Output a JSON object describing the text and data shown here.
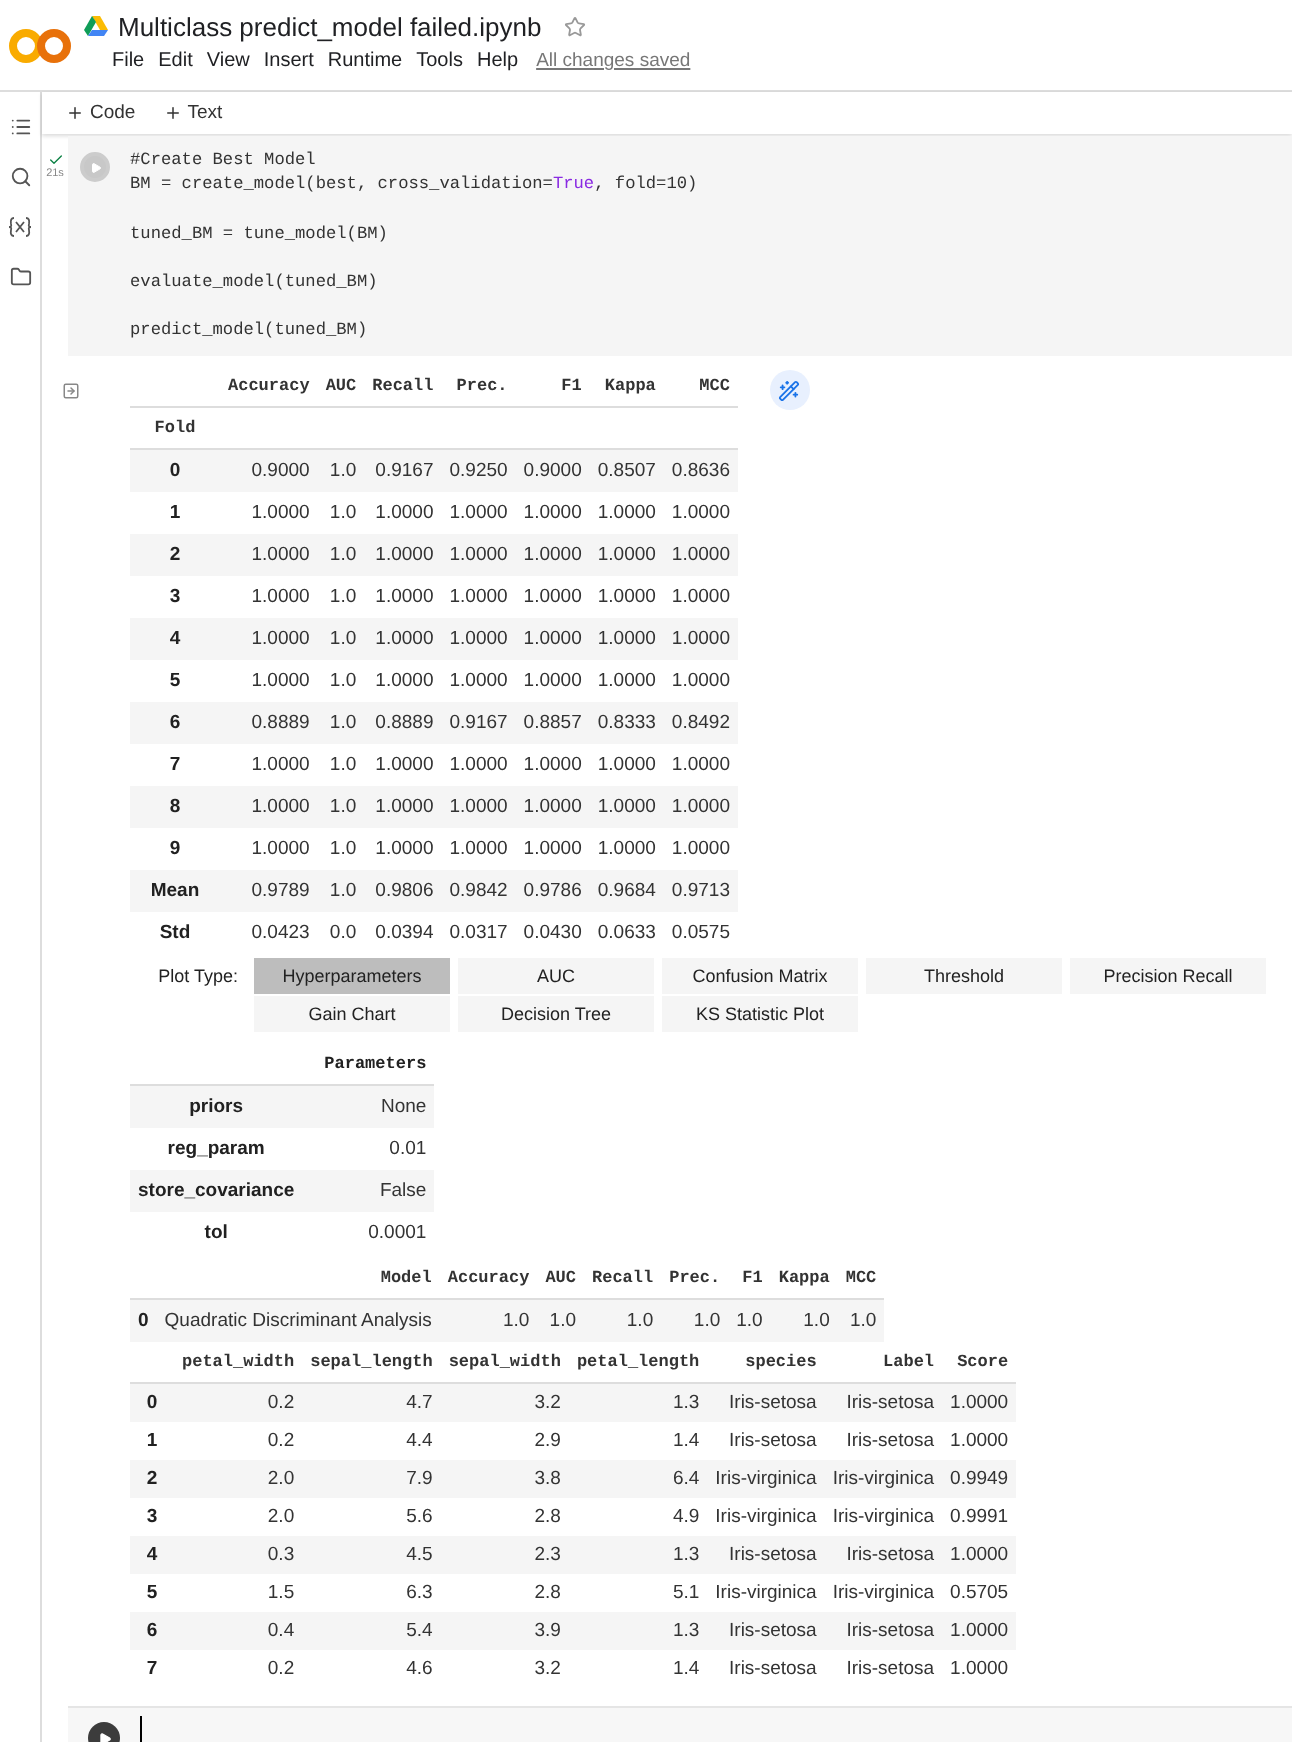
{
  "header": {
    "title": "Multiclass predict_model failed.ipynb",
    "menu": [
      "File",
      "Edit",
      "View",
      "Insert",
      "Runtime",
      "Tools",
      "Help"
    ],
    "save_status": "All changes saved"
  },
  "toolbar": [
    "Code",
    "Text"
  ],
  "code_cell": {
    "exec_time": "21s",
    "done": true,
    "blocks": [
      [
        [
          {
            "text": "#Create Best Model",
            "kind": "comment"
          }
        ],
        [
          {
            "text": "BM = create_model(best, cross_validation=",
            "kind": "plain"
          },
          {
            "text": "True",
            "kind": "keyword"
          },
          {
            "text": ", fold=10)",
            "kind": "plain"
          }
        ]
      ],
      [
        [
          {
            "text": "tuned_BM = tune_model(BM)",
            "kind": "plain"
          }
        ]
      ],
      [
        [
          {
            "text": "evaluate_model(tuned_BM)",
            "kind": "plain"
          }
        ]
      ],
      [
        [
          {
            "text": "predict_model(tuned_BM)",
            "kind": "plain"
          }
        ]
      ]
    ]
  },
  "scores": {
    "columns": [
      "Accuracy",
      "AUC",
      "Recall",
      "Prec.",
      "F1",
      "Kappa",
      "MCC"
    ],
    "index_name": "Fold",
    "rows": [
      {
        "index": "0",
        "values": [
          "0.9000",
          "1.0",
          "0.9167",
          "0.9250",
          "0.9000",
          "0.8507",
          "0.8636"
        ]
      },
      {
        "index": "1",
        "values": [
          "1.0000",
          "1.0",
          "1.0000",
          "1.0000",
          "1.0000",
          "1.0000",
          "1.0000"
        ]
      },
      {
        "index": "2",
        "values": [
          "1.0000",
          "1.0",
          "1.0000",
          "1.0000",
          "1.0000",
          "1.0000",
          "1.0000"
        ]
      },
      {
        "index": "3",
        "values": [
          "1.0000",
          "1.0",
          "1.0000",
          "1.0000",
          "1.0000",
          "1.0000",
          "1.0000"
        ]
      },
      {
        "index": "4",
        "values": [
          "1.0000",
          "1.0",
          "1.0000",
          "1.0000",
          "1.0000",
          "1.0000",
          "1.0000"
        ]
      },
      {
        "index": "5",
        "values": [
          "1.0000",
          "1.0",
          "1.0000",
          "1.0000",
          "1.0000",
          "1.0000",
          "1.0000"
        ]
      },
      {
        "index": "6",
        "values": [
          "0.8889",
          "1.0",
          "0.8889",
          "0.9167",
          "0.8857",
          "0.8333",
          "0.8492"
        ]
      },
      {
        "index": "7",
        "values": [
          "1.0000",
          "1.0",
          "1.0000",
          "1.0000",
          "1.0000",
          "1.0000",
          "1.0000"
        ]
      },
      {
        "index": "8",
        "values": [
          "1.0000",
          "1.0",
          "1.0000",
          "1.0000",
          "1.0000",
          "1.0000",
          "1.0000"
        ]
      },
      {
        "index": "9",
        "values": [
          "1.0000",
          "1.0",
          "1.0000",
          "1.0000",
          "1.0000",
          "1.0000",
          "1.0000"
        ]
      },
      {
        "index": "Mean",
        "values": [
          "0.9789",
          "1.0",
          "0.9806",
          "0.9842",
          "0.9786",
          "0.9684",
          "0.9713"
        ]
      },
      {
        "index": "Std",
        "values": [
          "0.0423",
          "0.0",
          "0.0394",
          "0.0317",
          "0.0430",
          "0.0633",
          "0.0575"
        ]
      }
    ]
  },
  "plot_type": {
    "label": "Plot Type:",
    "options": [
      {
        "label": "Hyperparameters",
        "selected": true
      },
      {
        "label": "AUC",
        "selected": false
      },
      {
        "label": "Confusion Matrix",
        "selected": false
      },
      {
        "label": "Threshold",
        "selected": false
      },
      {
        "label": "Precision Recall",
        "selected": false
      },
      {
        "label": "Gain Chart",
        "selected": false
      },
      {
        "label": "Decision Tree",
        "selected": false
      },
      {
        "label": "KS Statistic Plot",
        "selected": false
      }
    ]
  },
  "parameters": {
    "header": "Parameters",
    "rows": [
      {
        "name": "priors",
        "value": "None"
      },
      {
        "name": "reg_param",
        "value": "0.01"
      },
      {
        "name": "store_covariance",
        "value": "False"
      },
      {
        "name": "tol",
        "value": "0.0001"
      }
    ]
  },
  "model_table": {
    "columns": [
      "Model",
      "Accuracy",
      "AUC",
      "Recall",
      "Prec.",
      "F1",
      "Kappa",
      "MCC"
    ],
    "rows": [
      {
        "index": "0",
        "values": [
          "Quadratic Discriminant Analysis",
          "1.0",
          "1.0",
          "1.0",
          "1.0",
          "1.0",
          "1.0",
          "1.0"
        ]
      }
    ]
  },
  "predictions": {
    "columns": [
      "petal_width",
      "sepal_length",
      "sepal_width",
      "petal_length",
      "species",
      "Label",
      "Score"
    ],
    "rows": [
      {
        "index": "0",
        "values": [
          "0.2",
          "4.7",
          "3.2",
          "1.3",
          "Iris-setosa",
          "Iris-setosa",
          "1.0000"
        ]
      },
      {
        "index": "1",
        "values": [
          "0.2",
          "4.4",
          "2.9",
          "1.4",
          "Iris-setosa",
          "Iris-setosa",
          "1.0000"
        ]
      },
      {
        "index": "2",
        "values": [
          "2.0",
          "7.9",
          "3.8",
          "6.4",
          "Iris-virginica",
          "Iris-virginica",
          "0.9949"
        ]
      },
      {
        "index": "3",
        "values": [
          "2.0",
          "5.6",
          "2.8",
          "4.9",
          "Iris-virginica",
          "Iris-virginica",
          "0.9991"
        ]
      },
      {
        "index": "4",
        "values": [
          "0.3",
          "4.5",
          "2.3",
          "1.3",
          "Iris-setosa",
          "Iris-setosa",
          "1.0000"
        ]
      },
      {
        "index": "5",
        "values": [
          "1.5",
          "6.3",
          "2.8",
          "5.1",
          "Iris-virginica",
          "Iris-virginica",
          "0.5705"
        ]
      },
      {
        "index": "6",
        "values": [
          "0.4",
          "5.4",
          "3.9",
          "1.3",
          "Iris-setosa",
          "Iris-setosa",
          "1.0000"
        ]
      },
      {
        "index": "7",
        "values": [
          "0.2",
          "4.6",
          "3.2",
          "1.4",
          "Iris-setosa",
          "Iris-setosa",
          "1.0000"
        ]
      }
    ]
  }
}
